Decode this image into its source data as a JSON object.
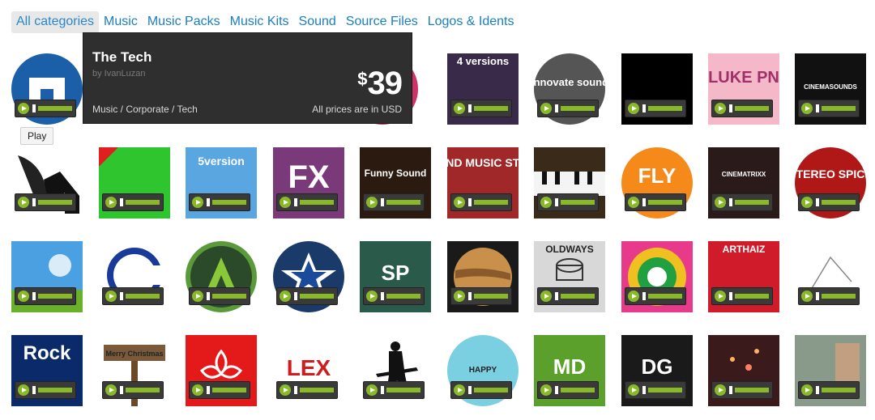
{
  "tabs": [
    "All categories",
    "Music",
    "Music Packs",
    "Music Kits",
    "Sound",
    "Source Files",
    "Logos & Idents"
  ],
  "active_tab": 0,
  "tooltip": {
    "title": "The Tech",
    "author": "by IvanLuzan",
    "category": "Music / Corporate / Tech",
    "price_symbol": "$",
    "price": "39",
    "note": "All prices are in USD"
  },
  "play_tooltip": "Play",
  "tiles": [
    {
      "name": "the-tech",
      "text": "",
      "bg": "#1a5fa8"
    },
    {
      "name": "tile-2",
      "text": "",
      "bg": "#cc3366"
    },
    {
      "name": "tile-3",
      "text": "",
      "bg": "#d0d0d0"
    },
    {
      "name": "tile-4",
      "text": "",
      "bg": "#d8d8d8"
    },
    {
      "name": "tile-5",
      "text": "4 versions",
      "bg": "#3a2a4a"
    },
    {
      "name": "innovate-sound",
      "text": "innovate sound",
      "bg": "#555555"
    },
    {
      "name": "tile-7",
      "text": "",
      "bg": "#000000"
    },
    {
      "name": "luke-pn",
      "text": "LUKE PN",
      "bg": "#f4b8c8"
    },
    {
      "name": "cinemasounds",
      "text": "CINEMASOUNDS",
      "bg": "#111111"
    },
    {
      "name": "wing-m",
      "text": "",
      "bg": "#ffffff"
    },
    {
      "name": "green-tile",
      "text": "",
      "bg": "#2ec52e"
    },
    {
      "name": "5version",
      "text": "5version",
      "bg": "#5aa6e0"
    },
    {
      "name": "fx",
      "text": "FX",
      "bg": "#7a3a7a"
    },
    {
      "name": "funny-sound",
      "text": "Funny Sound",
      "bg": "#2a1a10"
    },
    {
      "name": "sound-music-stock",
      "text": "SOUND MUSIC STOCK",
      "bg": "#a02828"
    },
    {
      "name": "piano",
      "text": "",
      "bg": "#3a2a1a"
    },
    {
      "name": "fly",
      "text": "FLY",
      "bg": "#f58a1a"
    },
    {
      "name": "cinematrixx",
      "text": "CINEMATRIXX",
      "bg": "#2a1a1a"
    },
    {
      "name": "stereo-spice",
      "text": "STEREO SPICE",
      "bg": "#b01818"
    },
    {
      "name": "sky",
      "text": "",
      "bg": "#4aa0e0"
    },
    {
      "name": "c-logo",
      "text": "",
      "bg": "#ffffff"
    },
    {
      "name": "a-logo",
      "text": "",
      "bg": "#ffffff"
    },
    {
      "name": "star",
      "text": "",
      "bg": "#1a3a6a"
    },
    {
      "name": "sp",
      "text": "SP",
      "bg": "#2a5a4a"
    },
    {
      "name": "jupiter",
      "text": "",
      "bg": "#1a1a1a"
    },
    {
      "name": "oldways",
      "text": "OLDWAYS",
      "bg": "#d8d8d8"
    },
    {
      "name": "spiral",
      "text": "",
      "bg": "#e83a8a"
    },
    {
      "name": "arthaiz",
      "text": "ARTHAIZ",
      "bg": "#d01c2a"
    },
    {
      "name": "b-logo",
      "text": "",
      "bg": "#ffffff"
    },
    {
      "name": "rock",
      "text": "Rock",
      "bg": "#0a2a6a"
    },
    {
      "name": "merry-christmas",
      "text": "Merry Christmas",
      "bg": "#ffffff"
    },
    {
      "name": "red-flower",
      "text": "",
      "bg": "#e41a1a"
    },
    {
      "name": "lex",
      "text": "LEX",
      "bg": "#ffffff"
    },
    {
      "name": "guitarist",
      "text": "",
      "bg": "#ffffff"
    },
    {
      "name": "happy",
      "text": "HAPPY",
      "bg": "#7acfe0"
    },
    {
      "name": "md",
      "text": "MD",
      "bg": "#5aa02a"
    },
    {
      "name": "dg",
      "text": "DG",
      "bg": "#1a1a1a"
    },
    {
      "name": "lights",
      "text": "",
      "bg": "#3a1a1a"
    },
    {
      "name": "photo",
      "text": "",
      "bg": "#8a9a8a"
    }
  ]
}
